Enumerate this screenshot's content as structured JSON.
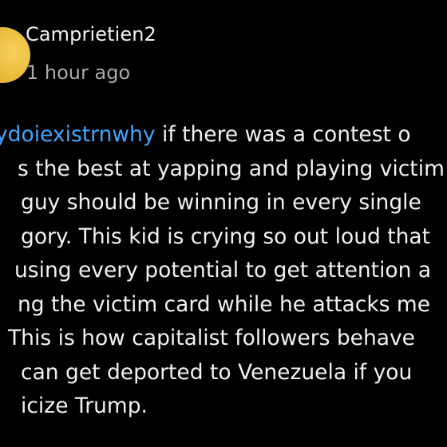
{
  "comment": {
    "username": "Camprietien2",
    "timestamp": "1 hour ago",
    "mention": "ydoiexistrnwhy",
    "lines": [
      " if there was a contest o",
      "s the best at yapping and playing victim",
      "guy should be winning in every single",
      "gory. This kid is crying so out loud that",
      "using every potential to get attention a",
      "ng the victim card while he attacks me",
      " This is how capitalist followers behave",
      "can get deported to Venezuela if you",
      "icize Trump."
    ]
  },
  "colors": {
    "background": "#000000",
    "text": "#f1f1f1",
    "secondary": "#aaaaaa",
    "mention": "#3ea6ff",
    "avatar": "#e9b93a"
  }
}
